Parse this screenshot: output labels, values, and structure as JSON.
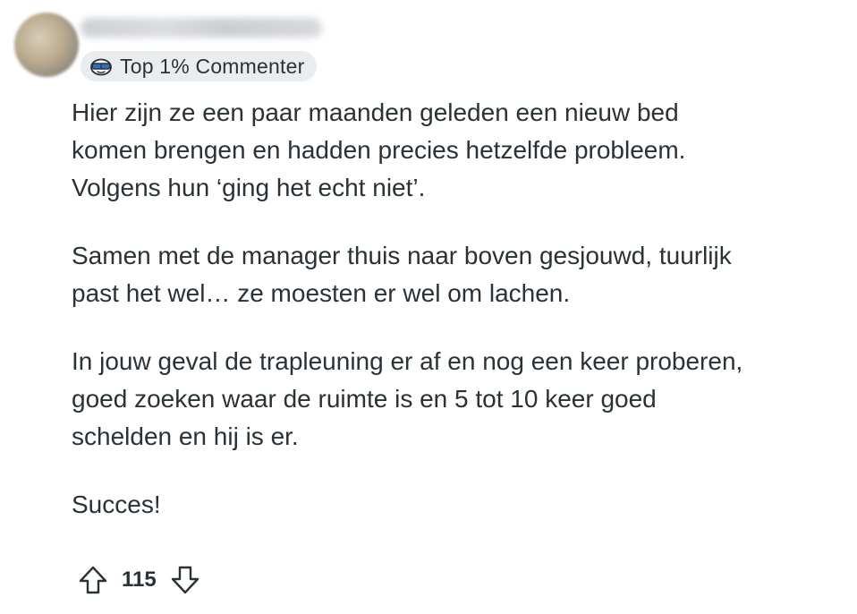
{
  "comment": {
    "badge": {
      "icon": "sunglasses-snoo-icon",
      "label": "Top 1% Commenter"
    },
    "paragraphs": [
      "Hier zijn ze een paar maanden geleden een nieuw bed\nkomen brengen en hadden precies hetzelfde probleem.\nVolgens hun ‘ging het echt niet’.",
      "Samen met de manager thuis naar boven gesjouwd, tuurlijk\npast het wel… ze moesten er wel om lachen.",
      "In jouw geval de trapleuning er af en nog een keer proberen,\ngoed zoeken waar de ruimte is en 5 tot 10 keer goed\nschelden en hij is er.",
      "Succes!"
    ],
    "actions": {
      "upvote_icon": "upvote-arrow-icon",
      "score": "115",
      "downvote_icon": "downvote-arrow-icon"
    }
  },
  "colors": {
    "text": "#2a3236",
    "badge_bg": "#eaedef",
    "badge_icon_blue": "#3b82c4",
    "page_bg": "#ffffff"
  }
}
